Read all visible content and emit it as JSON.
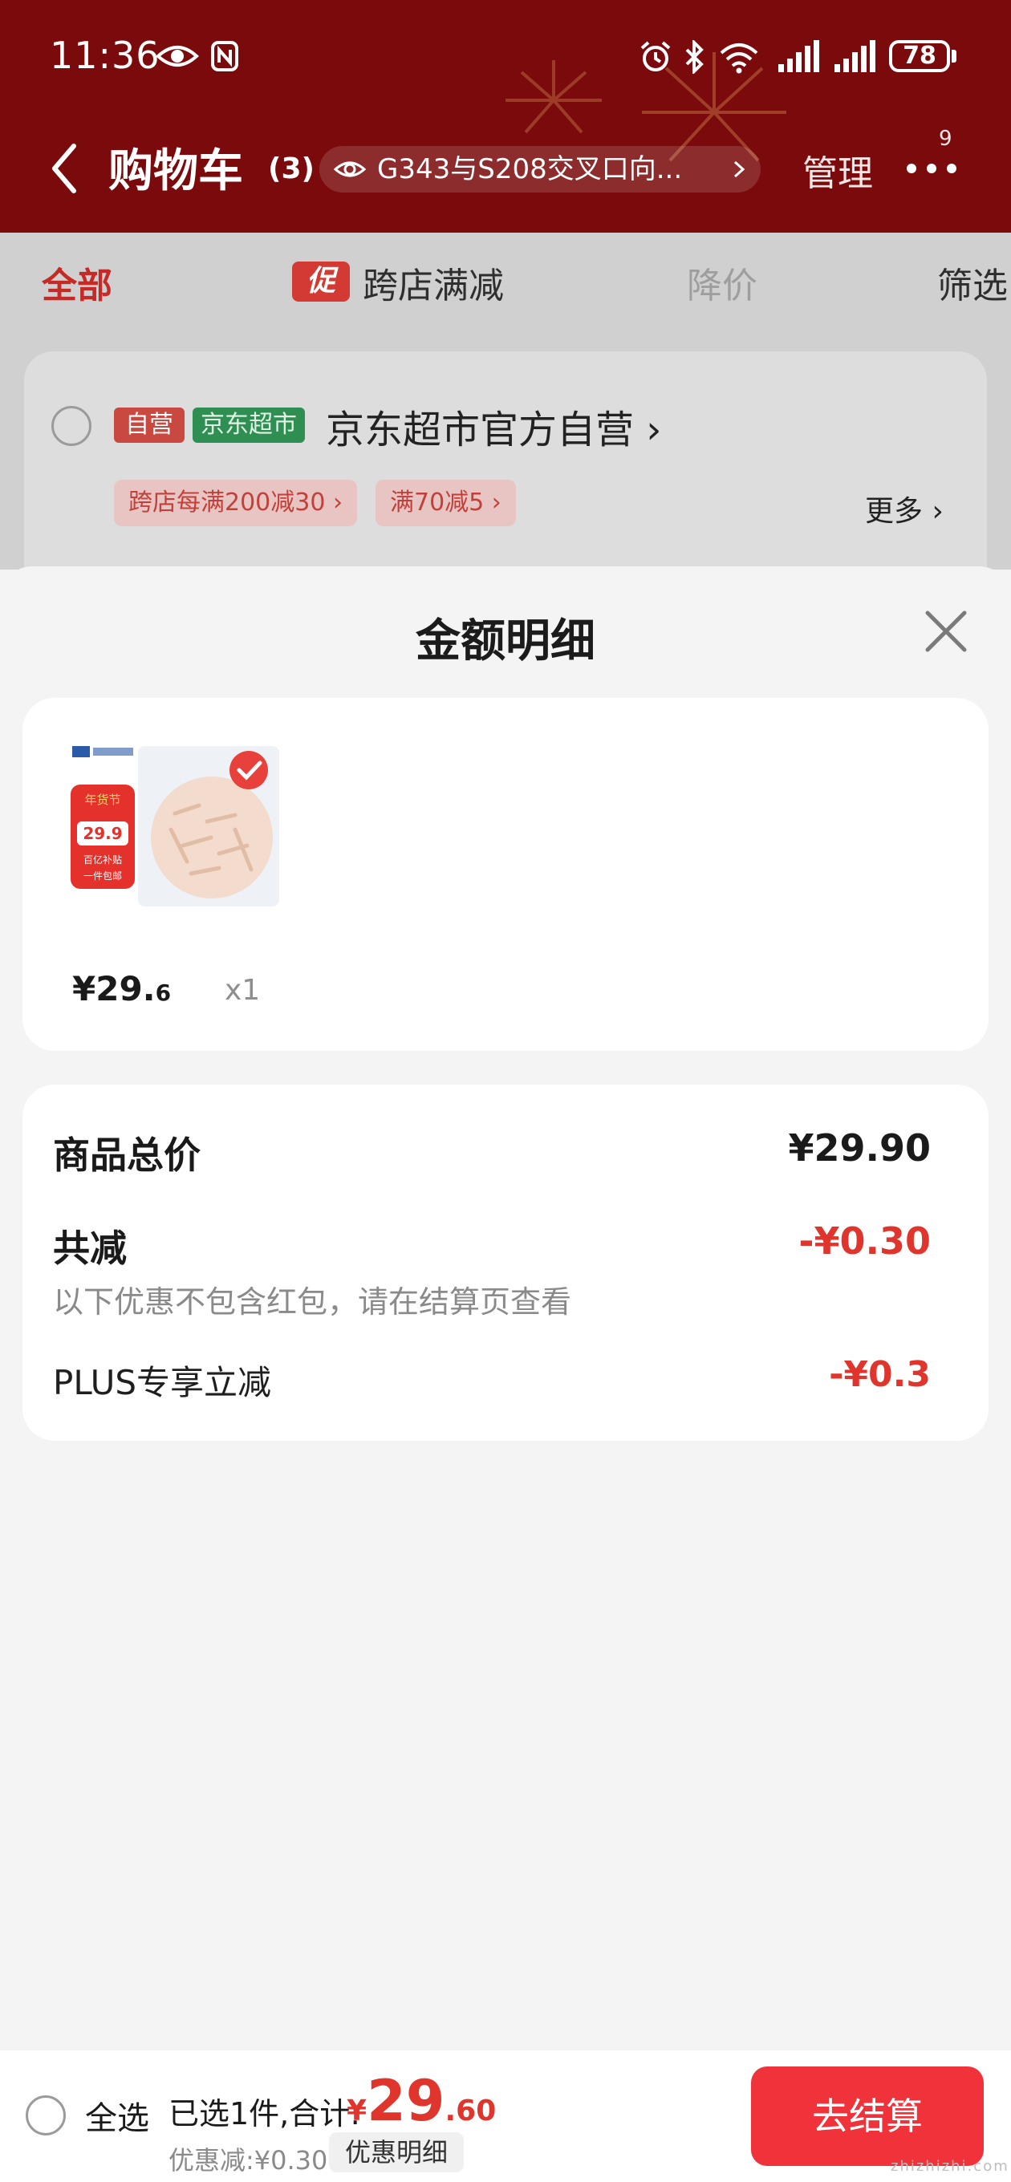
{
  "status_bar": {
    "time": "11:36",
    "battery": "78",
    "icons": [
      "eye-icon",
      "nfc-icon",
      "alarm-icon",
      "bluetooth-icon",
      "wifi-icon",
      "signal-icon",
      "signal-icon"
    ]
  },
  "header": {
    "title": "购物车",
    "count": "(3)",
    "location": "G343与S208交叉口向...",
    "manage": "管理",
    "message_badge": "9"
  },
  "tabs": {
    "all": "全部",
    "promo_tag": "促",
    "cross_store": "跨店满减",
    "price_drop": "降价",
    "filter": "筛选"
  },
  "shop": {
    "tag_self": "自营",
    "tag_jd": "京东超市",
    "name": "京东超市官方自营 ›",
    "promos": [
      "跨店每满200减30 ›",
      "满70减5 ›"
    ],
    "more": "更多 ›"
  },
  "sheet": {
    "title": "金额明细",
    "item": {
      "price_int": "¥29.",
      "price_dec": "6",
      "qty": "x1",
      "image_texts": [
        "年货节",
        "29.9",
        "百亿补贴",
        "一件包邮"
      ]
    },
    "summary": {
      "total_label": "商品总价",
      "total_value": "¥29.90",
      "reduce_label": "共减",
      "reduce_value": "-¥0.30",
      "note": "以下优惠不包含红包，请在结算页查看",
      "plus_label": "PLUS专享立减",
      "plus_value": "-¥0.3"
    }
  },
  "bottom": {
    "select_all": "全选",
    "summary_text": "已选1件,合计:",
    "total_yen": "¥",
    "total_int": "29",
    "total_dec": ".60",
    "discount": "优惠减:¥0.30",
    "detail_button": "优惠明细",
    "checkout": "去结算"
  },
  "watermark": "zhizhizhi.com",
  "colors": {
    "header_bg": "#7a0a0b",
    "accent_red": "#e0352c",
    "checkout_bg": "#f0323a",
    "jd_green": "#2f8f52"
  }
}
